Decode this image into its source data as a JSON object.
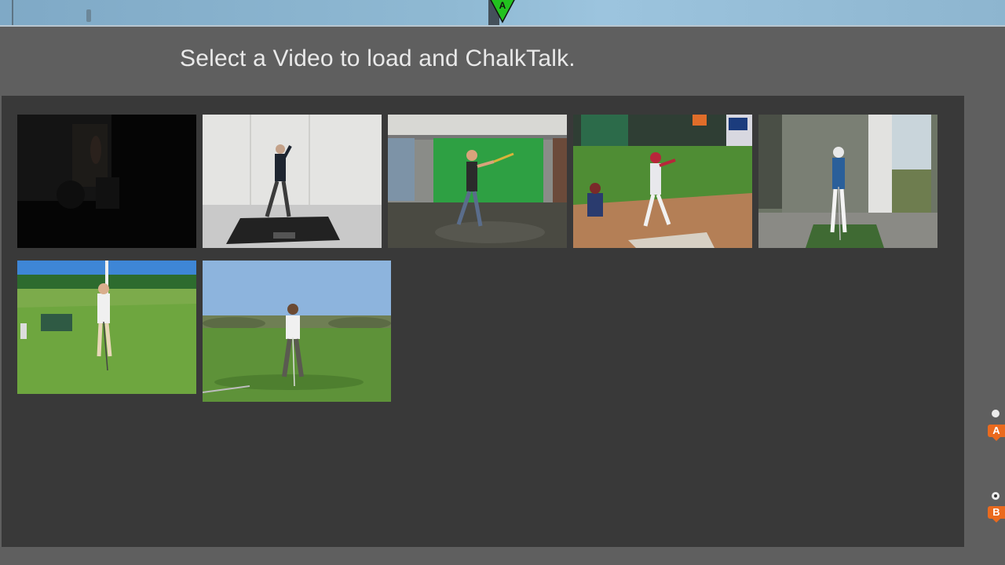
{
  "header": {
    "title": "Select a Video to load and ChalkTalk.",
    "top_marker_label": "A"
  },
  "videos": [
    {
      "name": "Dark room video",
      "icon": "video-thumbnail"
    },
    {
      "name": "Golfer indoor studio",
      "icon": "video-thumbnail"
    },
    {
      "name": "Batter green screen",
      "icon": "video-thumbnail"
    },
    {
      "name": "Baseball game swing",
      "icon": "video-thumbnail"
    },
    {
      "name": "Golfer practice mat",
      "icon": "video-thumbnail"
    },
    {
      "name": "Golfer driving range",
      "icon": "video-thumbnail"
    },
    {
      "name": "Golfer fairway address",
      "icon": "video-thumbnail"
    }
  ],
  "side_markers": [
    {
      "label": "A",
      "color": "#ea6a1e"
    },
    {
      "label": "B",
      "color": "#ea6a1e"
    }
  ],
  "colors": {
    "background": "#5f5f5f",
    "panel": "#393939",
    "title_text": "#e9e9e9",
    "marker_green": "#22c21f",
    "marker_orange": "#ea6a1e"
  }
}
